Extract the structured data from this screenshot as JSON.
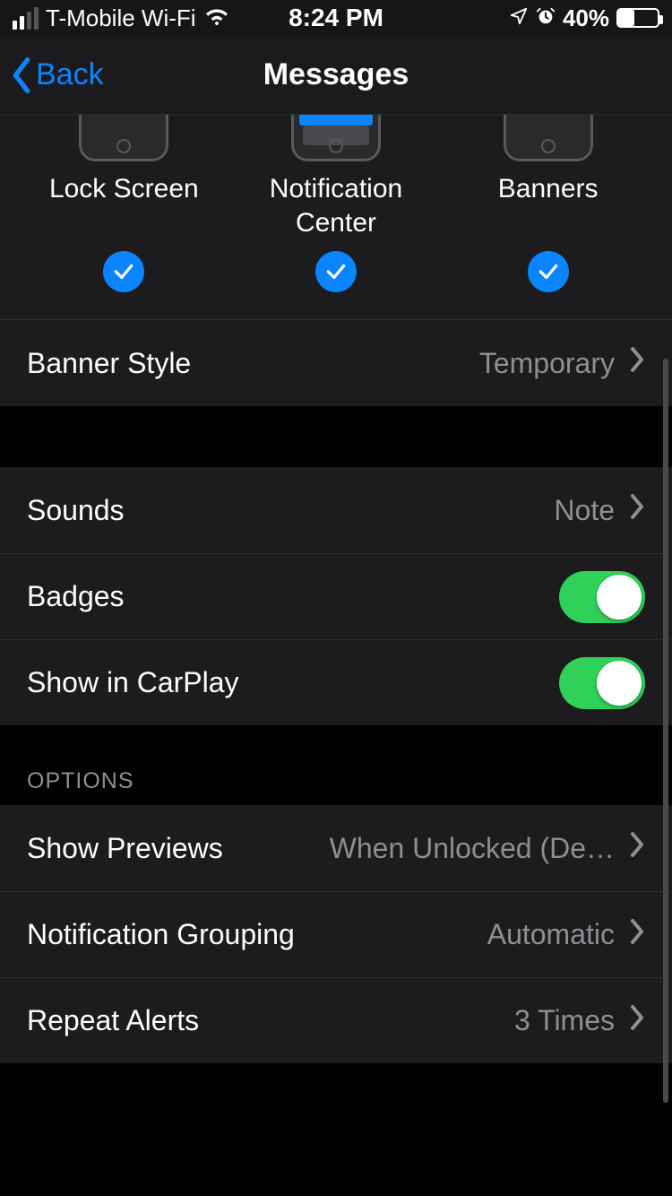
{
  "status": {
    "carrier": "T-Mobile Wi-Fi",
    "time": "8:24 PM",
    "battery_pct": "40%"
  },
  "nav": {
    "back_label": "Back",
    "title": "Messages"
  },
  "alerts": {
    "options": [
      {
        "label": "Lock Screen",
        "checked": true
      },
      {
        "label": "Notification Center",
        "checked": true
      },
      {
        "label": "Banners",
        "checked": true
      }
    ]
  },
  "rows": {
    "banner_style": {
      "label": "Banner Style",
      "value": "Temporary"
    },
    "sounds": {
      "label": "Sounds",
      "value": "Note"
    },
    "badges": {
      "label": "Badges"
    },
    "carplay": {
      "label": "Show in CarPlay"
    }
  },
  "options_header": "OPTIONS",
  "options": {
    "previews": {
      "label": "Show Previews",
      "value": "When Unlocked (De…"
    },
    "grouping": {
      "label": "Notification Grouping",
      "value": "Automatic"
    },
    "repeat": {
      "label": "Repeat Alerts",
      "value": "3 Times"
    }
  }
}
